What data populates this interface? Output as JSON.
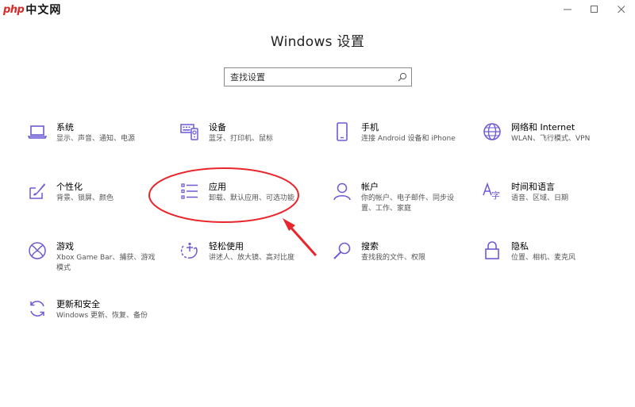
{
  "watermark": {
    "php": "php",
    "cn": "中文网"
  },
  "window": {
    "title": "Windows 设置"
  },
  "search": {
    "placeholder": "查找设置"
  },
  "tiles": [
    {
      "name": "系统",
      "desc": "显示、声音、通知、电源",
      "icon": "laptop-icon"
    },
    {
      "name": "设备",
      "desc": "蓝牙、打印机、鼠标",
      "icon": "keyboard-devices-icon"
    },
    {
      "name": "手机",
      "desc": "连接 Android 设备和 iPhone",
      "icon": "phone-icon"
    },
    {
      "name": "网络和 Internet",
      "desc": "WLAN、飞行模式、VPN",
      "icon": "globe-icon"
    },
    {
      "name": "个性化",
      "desc": "背景、锁屏、颜色",
      "icon": "paint-brush-icon"
    },
    {
      "name": "应用",
      "desc": "卸载、默认应用、可选功能",
      "icon": "app-list-icon"
    },
    {
      "name": "帐户",
      "desc": "你的帐户、电子邮件、同步设置、工作、家庭",
      "icon": "person-icon"
    },
    {
      "name": "时间和语言",
      "desc": "语音、区域、日期",
      "icon": "time-language-icon"
    },
    {
      "name": "游戏",
      "desc": "Xbox Game Bar、捕获、游戏模式",
      "icon": "xbox-icon"
    },
    {
      "name": "轻松使用",
      "desc": "讲述人、放大镜、高对比度",
      "icon": "ease-of-access-icon"
    },
    {
      "name": "搜索",
      "desc": "查找我的文件、权限",
      "icon": "magnifier-icon"
    },
    {
      "name": "隐私",
      "desc": "位置、相机、麦克风",
      "icon": "lock-icon"
    },
    {
      "name": "更新和安全",
      "desc": "Windows 更新、恢复、备份",
      "icon": "refresh-icon"
    }
  ],
  "colors": {
    "accent": "#6b5bd6",
    "annotation": "#e8262b"
  }
}
